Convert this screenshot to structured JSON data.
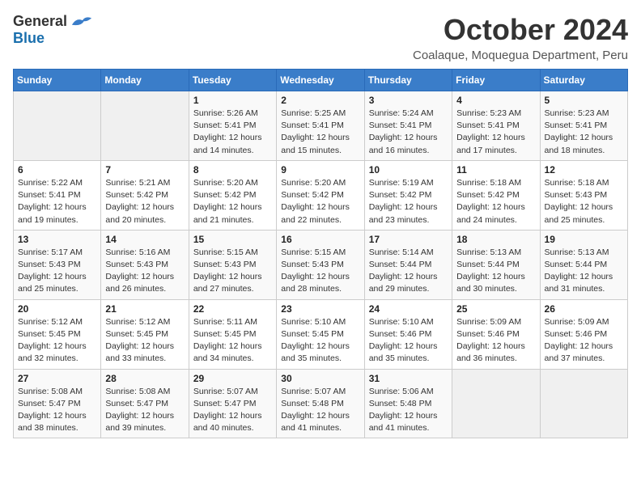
{
  "logo": {
    "general": "General",
    "blue": "Blue"
  },
  "title": "October 2024",
  "subtitle": "Coalaque, Moquegua Department, Peru",
  "days_header": [
    "Sunday",
    "Monday",
    "Tuesday",
    "Wednesday",
    "Thursday",
    "Friday",
    "Saturday"
  ],
  "weeks": [
    [
      {
        "day": "",
        "info": ""
      },
      {
        "day": "",
        "info": ""
      },
      {
        "day": "1",
        "info": "Sunrise: 5:26 AM\nSunset: 5:41 PM\nDaylight: 12 hours and 14 minutes."
      },
      {
        "day": "2",
        "info": "Sunrise: 5:25 AM\nSunset: 5:41 PM\nDaylight: 12 hours and 15 minutes."
      },
      {
        "day": "3",
        "info": "Sunrise: 5:24 AM\nSunset: 5:41 PM\nDaylight: 12 hours and 16 minutes."
      },
      {
        "day": "4",
        "info": "Sunrise: 5:23 AM\nSunset: 5:41 PM\nDaylight: 12 hours and 17 minutes."
      },
      {
        "day": "5",
        "info": "Sunrise: 5:23 AM\nSunset: 5:41 PM\nDaylight: 12 hours and 18 minutes."
      }
    ],
    [
      {
        "day": "6",
        "info": "Sunrise: 5:22 AM\nSunset: 5:41 PM\nDaylight: 12 hours and 19 minutes."
      },
      {
        "day": "7",
        "info": "Sunrise: 5:21 AM\nSunset: 5:42 PM\nDaylight: 12 hours and 20 minutes."
      },
      {
        "day": "8",
        "info": "Sunrise: 5:20 AM\nSunset: 5:42 PM\nDaylight: 12 hours and 21 minutes."
      },
      {
        "day": "9",
        "info": "Sunrise: 5:20 AM\nSunset: 5:42 PM\nDaylight: 12 hours and 22 minutes."
      },
      {
        "day": "10",
        "info": "Sunrise: 5:19 AM\nSunset: 5:42 PM\nDaylight: 12 hours and 23 minutes."
      },
      {
        "day": "11",
        "info": "Sunrise: 5:18 AM\nSunset: 5:42 PM\nDaylight: 12 hours and 24 minutes."
      },
      {
        "day": "12",
        "info": "Sunrise: 5:18 AM\nSunset: 5:43 PM\nDaylight: 12 hours and 25 minutes."
      }
    ],
    [
      {
        "day": "13",
        "info": "Sunrise: 5:17 AM\nSunset: 5:43 PM\nDaylight: 12 hours and 25 minutes."
      },
      {
        "day": "14",
        "info": "Sunrise: 5:16 AM\nSunset: 5:43 PM\nDaylight: 12 hours and 26 minutes."
      },
      {
        "day": "15",
        "info": "Sunrise: 5:15 AM\nSunset: 5:43 PM\nDaylight: 12 hours and 27 minutes."
      },
      {
        "day": "16",
        "info": "Sunrise: 5:15 AM\nSunset: 5:43 PM\nDaylight: 12 hours and 28 minutes."
      },
      {
        "day": "17",
        "info": "Sunrise: 5:14 AM\nSunset: 5:44 PM\nDaylight: 12 hours and 29 minutes."
      },
      {
        "day": "18",
        "info": "Sunrise: 5:13 AM\nSunset: 5:44 PM\nDaylight: 12 hours and 30 minutes."
      },
      {
        "day": "19",
        "info": "Sunrise: 5:13 AM\nSunset: 5:44 PM\nDaylight: 12 hours and 31 minutes."
      }
    ],
    [
      {
        "day": "20",
        "info": "Sunrise: 5:12 AM\nSunset: 5:45 PM\nDaylight: 12 hours and 32 minutes."
      },
      {
        "day": "21",
        "info": "Sunrise: 5:12 AM\nSunset: 5:45 PM\nDaylight: 12 hours and 33 minutes."
      },
      {
        "day": "22",
        "info": "Sunrise: 5:11 AM\nSunset: 5:45 PM\nDaylight: 12 hours and 34 minutes."
      },
      {
        "day": "23",
        "info": "Sunrise: 5:10 AM\nSunset: 5:45 PM\nDaylight: 12 hours and 35 minutes."
      },
      {
        "day": "24",
        "info": "Sunrise: 5:10 AM\nSunset: 5:46 PM\nDaylight: 12 hours and 35 minutes."
      },
      {
        "day": "25",
        "info": "Sunrise: 5:09 AM\nSunset: 5:46 PM\nDaylight: 12 hours and 36 minutes."
      },
      {
        "day": "26",
        "info": "Sunrise: 5:09 AM\nSunset: 5:46 PM\nDaylight: 12 hours and 37 minutes."
      }
    ],
    [
      {
        "day": "27",
        "info": "Sunrise: 5:08 AM\nSunset: 5:47 PM\nDaylight: 12 hours and 38 minutes."
      },
      {
        "day": "28",
        "info": "Sunrise: 5:08 AM\nSunset: 5:47 PM\nDaylight: 12 hours and 39 minutes."
      },
      {
        "day": "29",
        "info": "Sunrise: 5:07 AM\nSunset: 5:47 PM\nDaylight: 12 hours and 40 minutes."
      },
      {
        "day": "30",
        "info": "Sunrise: 5:07 AM\nSunset: 5:48 PM\nDaylight: 12 hours and 41 minutes."
      },
      {
        "day": "31",
        "info": "Sunrise: 5:06 AM\nSunset: 5:48 PM\nDaylight: 12 hours and 41 minutes."
      },
      {
        "day": "",
        "info": ""
      },
      {
        "day": "",
        "info": ""
      }
    ]
  ]
}
